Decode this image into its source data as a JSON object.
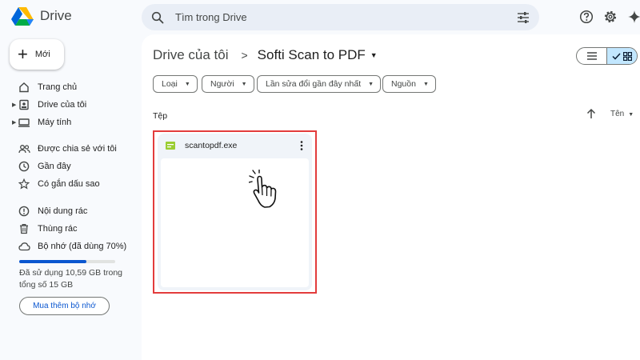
{
  "app": {
    "name": "Drive"
  },
  "search": {
    "placeholder": "Tìm trong Drive"
  },
  "header_icons": [
    "help-icon",
    "settings-icon",
    "gemini-icon"
  ],
  "sidebar": {
    "new_label": "Mới",
    "items": [
      {
        "label": "Trang chủ",
        "icon": "home-icon"
      },
      {
        "label": "Drive của tôi",
        "icon": "my-drive-icon"
      },
      {
        "label": "Máy tính",
        "icon": "computer-icon"
      },
      {
        "label": "Được chia sẻ với tôi",
        "icon": "shared-icon"
      },
      {
        "label": "Gần đây",
        "icon": "clock-icon"
      },
      {
        "label": "Có gắn dấu sao",
        "icon": "star-icon"
      },
      {
        "label": "Nội dung rác",
        "icon": "spam-icon"
      },
      {
        "label": "Thùng rác",
        "icon": "trash-icon"
      },
      {
        "label": "Bộ nhớ (đã dùng 70%)",
        "icon": "cloud-icon"
      }
    ],
    "storage_percent": 70,
    "storage_text": "Đã sử dụng 10,59 GB trong tổng số 15 GB",
    "buy_label": "Mua thêm bộ nhớ"
  },
  "breadcrumb": {
    "parent": "Drive của tôi",
    "separator": ">",
    "current": "Softi Scan to PDF"
  },
  "filters": [
    "Loại",
    "Người",
    "Lần sửa đổi gần đây nhất",
    "Nguồn"
  ],
  "files_section": {
    "label": "Tệp",
    "sort_label": "Tên"
  },
  "files": [
    {
      "name": "scantopdf.exe",
      "icon": "exe-file-icon"
    }
  ],
  "colors": {
    "accent": "#0b57d0",
    "selected": "#c2e7ff",
    "highlight": "#e33c3c",
    "panel": "#f8fafd"
  }
}
